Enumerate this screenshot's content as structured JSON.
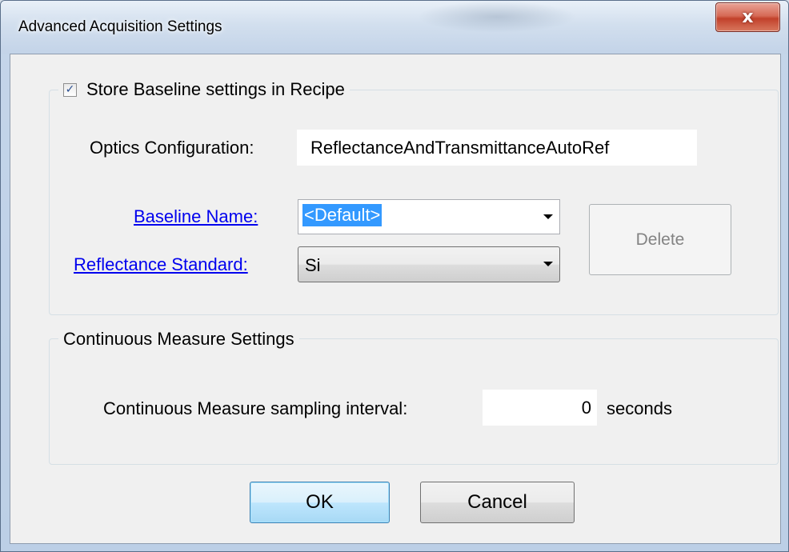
{
  "window": {
    "title": "Advanced Acquisition Settings",
    "close_glyph": "x"
  },
  "baseline_group": {
    "store_checked": true,
    "store_label": "Store Baseline settings in Recipe",
    "optics_label": "Optics Configuration:",
    "optics_value": "ReflectanceAndTransmittanceAutoRef",
    "baseline_name_label": "Baseline Name:",
    "baseline_name_value": "<Default>",
    "reflectance_label": "Reflectance Standard:",
    "reflectance_value": "Si",
    "delete_label": "Delete"
  },
  "continuous_group": {
    "title": "Continuous Measure Settings",
    "interval_label": "Continuous Measure sampling interval:",
    "interval_value": "0",
    "interval_unit": "seconds"
  },
  "buttons": {
    "ok": "OK",
    "cancel": "Cancel"
  },
  "colors": {
    "link": "#0000ee",
    "selection": "#3399ff"
  }
}
